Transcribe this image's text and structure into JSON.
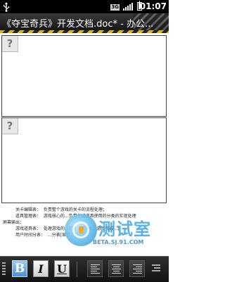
{
  "status_bar": {
    "time": "01:07",
    "network_label": "3G",
    "icons": [
      "usb-icon",
      "network-3g-icon",
      "signal-icon",
      "battery-icon"
    ]
  },
  "title_bar": {
    "title": "《夺宝奇兵》开发文档.doc* - 办公..."
  },
  "document": {
    "placeholder_glyph": "?",
    "lines": [
      {
        "label": "关卡编辑表：",
        "text": "负责整个游戏的关卡的流程处理；"
      },
      {
        "label": "道具管理表：",
        "text": "游戏核心的...负责生成道具使用的分类的实现处理"
      },
      {
        "label": "屏幕输出：",
        "text": ""
      },
      {
        "label": "游戏道具表：",
        "text": "处理游戏的...提高应用率[... 游戏完成...]"
      },
      {
        "label": "用户时间分表：",
        "text": "...分表[显示...]"
      }
    ]
  },
  "watermark": {
    "title": "测试室",
    "url": "BETA.SJ.91.COM"
  },
  "toolbar": {
    "bold_label": "B",
    "italic_label": "I",
    "underline_label": "U",
    "bold_active": true,
    "accent_color": "#4d8fd1"
  }
}
